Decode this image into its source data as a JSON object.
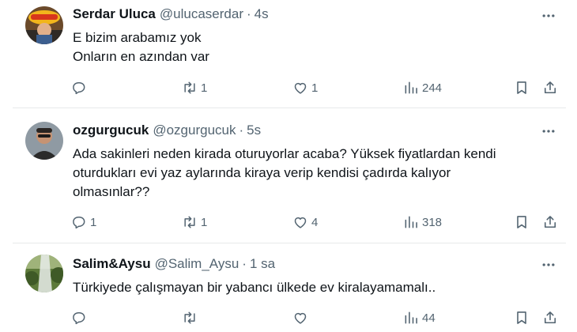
{
  "tweets": [
    {
      "name": "Serdar Uluca",
      "handle": "@ulucaserdar",
      "separator": "·",
      "time": "4s",
      "lines": [
        "E bizim arabamız yok",
        "Onların en azından var"
      ],
      "replies": "",
      "retweets": "1",
      "likes": "1",
      "views": "244"
    },
    {
      "name": "ozgurgucuk",
      "handle": "@ozgurgucuk",
      "separator": "·",
      "time": "5s",
      "lines": [
        "Ada sakinleri neden kirada oturuyorlar acaba? Yüksek fiyatlardan kendi",
        "oturdukları evi yaz aylarında kiraya verip kendisi çadırda kalıyor",
        "olmasınlar??"
      ],
      "replies": "1",
      "retweets": "1",
      "likes": "4",
      "views": "318"
    },
    {
      "name": "Salim&Aysu",
      "handle": "@Salim_Aysu",
      "separator": "·",
      "time": "1 sa",
      "lines": [
        "Türkiyede çalışmayan bir yabancı ülkede ev kiralayamamalı.."
      ],
      "replies": "",
      "retweets": "",
      "likes": "",
      "views": "44"
    }
  ],
  "icons": {
    "more": "more-horizontal-icon",
    "reply": "reply-bubble-icon",
    "retweet": "retweet-arrows-icon",
    "like": "heart-icon",
    "views": "bar-chart-icon",
    "bookmark": "bookmark-icon",
    "share": "share-upload-icon"
  },
  "colors": {
    "text": "#0f1419",
    "secondary": "#536471",
    "divider": "#e7e9ea"
  }
}
